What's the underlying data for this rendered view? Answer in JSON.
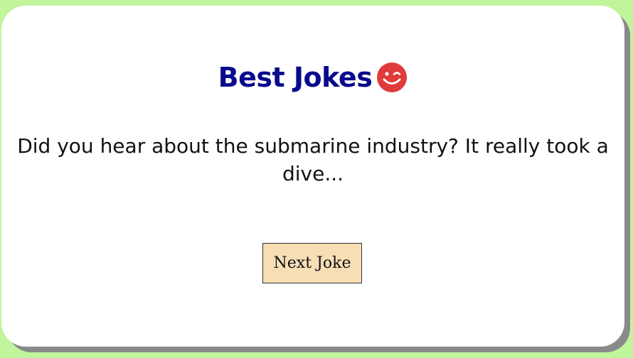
{
  "header": {
    "title": "Best Jokes",
    "title_icon": "winking-smiley-icon"
  },
  "joke": {
    "text": "Did you hear about the submarine industry? It really took a dive..."
  },
  "actions": {
    "next_label": "Next Joke"
  },
  "colors": {
    "page_background": "#c0f59c",
    "title": "#0a0a8c",
    "emoji": "#e03a3a",
    "button_background": "#f8deb5"
  }
}
